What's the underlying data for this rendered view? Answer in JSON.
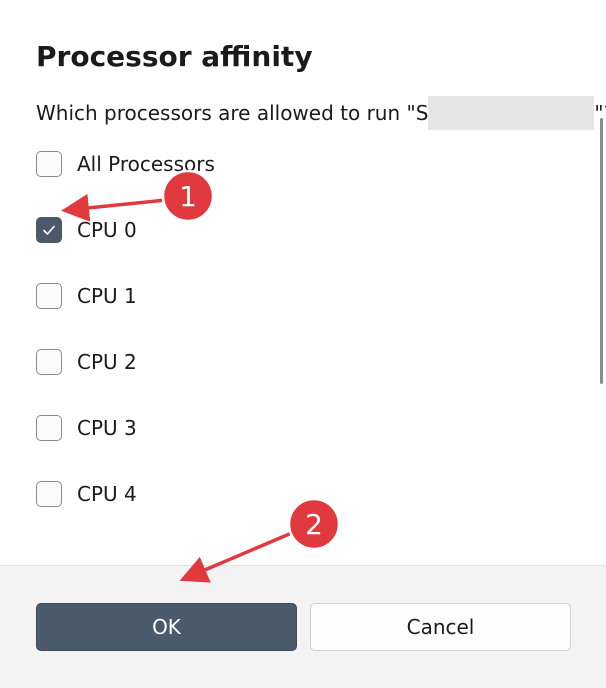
{
  "dialog": {
    "title": "Processor affinity",
    "question_prefix": "Which processors are allowed to run \"S",
    "question_suffix": "\"?"
  },
  "options": [
    {
      "label": "All Processors",
      "checked": false
    },
    {
      "label": "CPU 0",
      "checked": true
    },
    {
      "label": "CPU 1",
      "checked": false
    },
    {
      "label": "CPU 2",
      "checked": false
    },
    {
      "label": "CPU 3",
      "checked": false
    },
    {
      "label": "CPU 4",
      "checked": false
    }
  ],
  "buttons": {
    "ok_label": "OK",
    "cancel_label": "Cancel"
  },
  "annotations": {
    "marker_1": "1",
    "marker_2": "2",
    "marker_color": "#e0393e"
  },
  "colors": {
    "accent": "#4a5a6a",
    "footer_bg": "#f3f3f3"
  }
}
